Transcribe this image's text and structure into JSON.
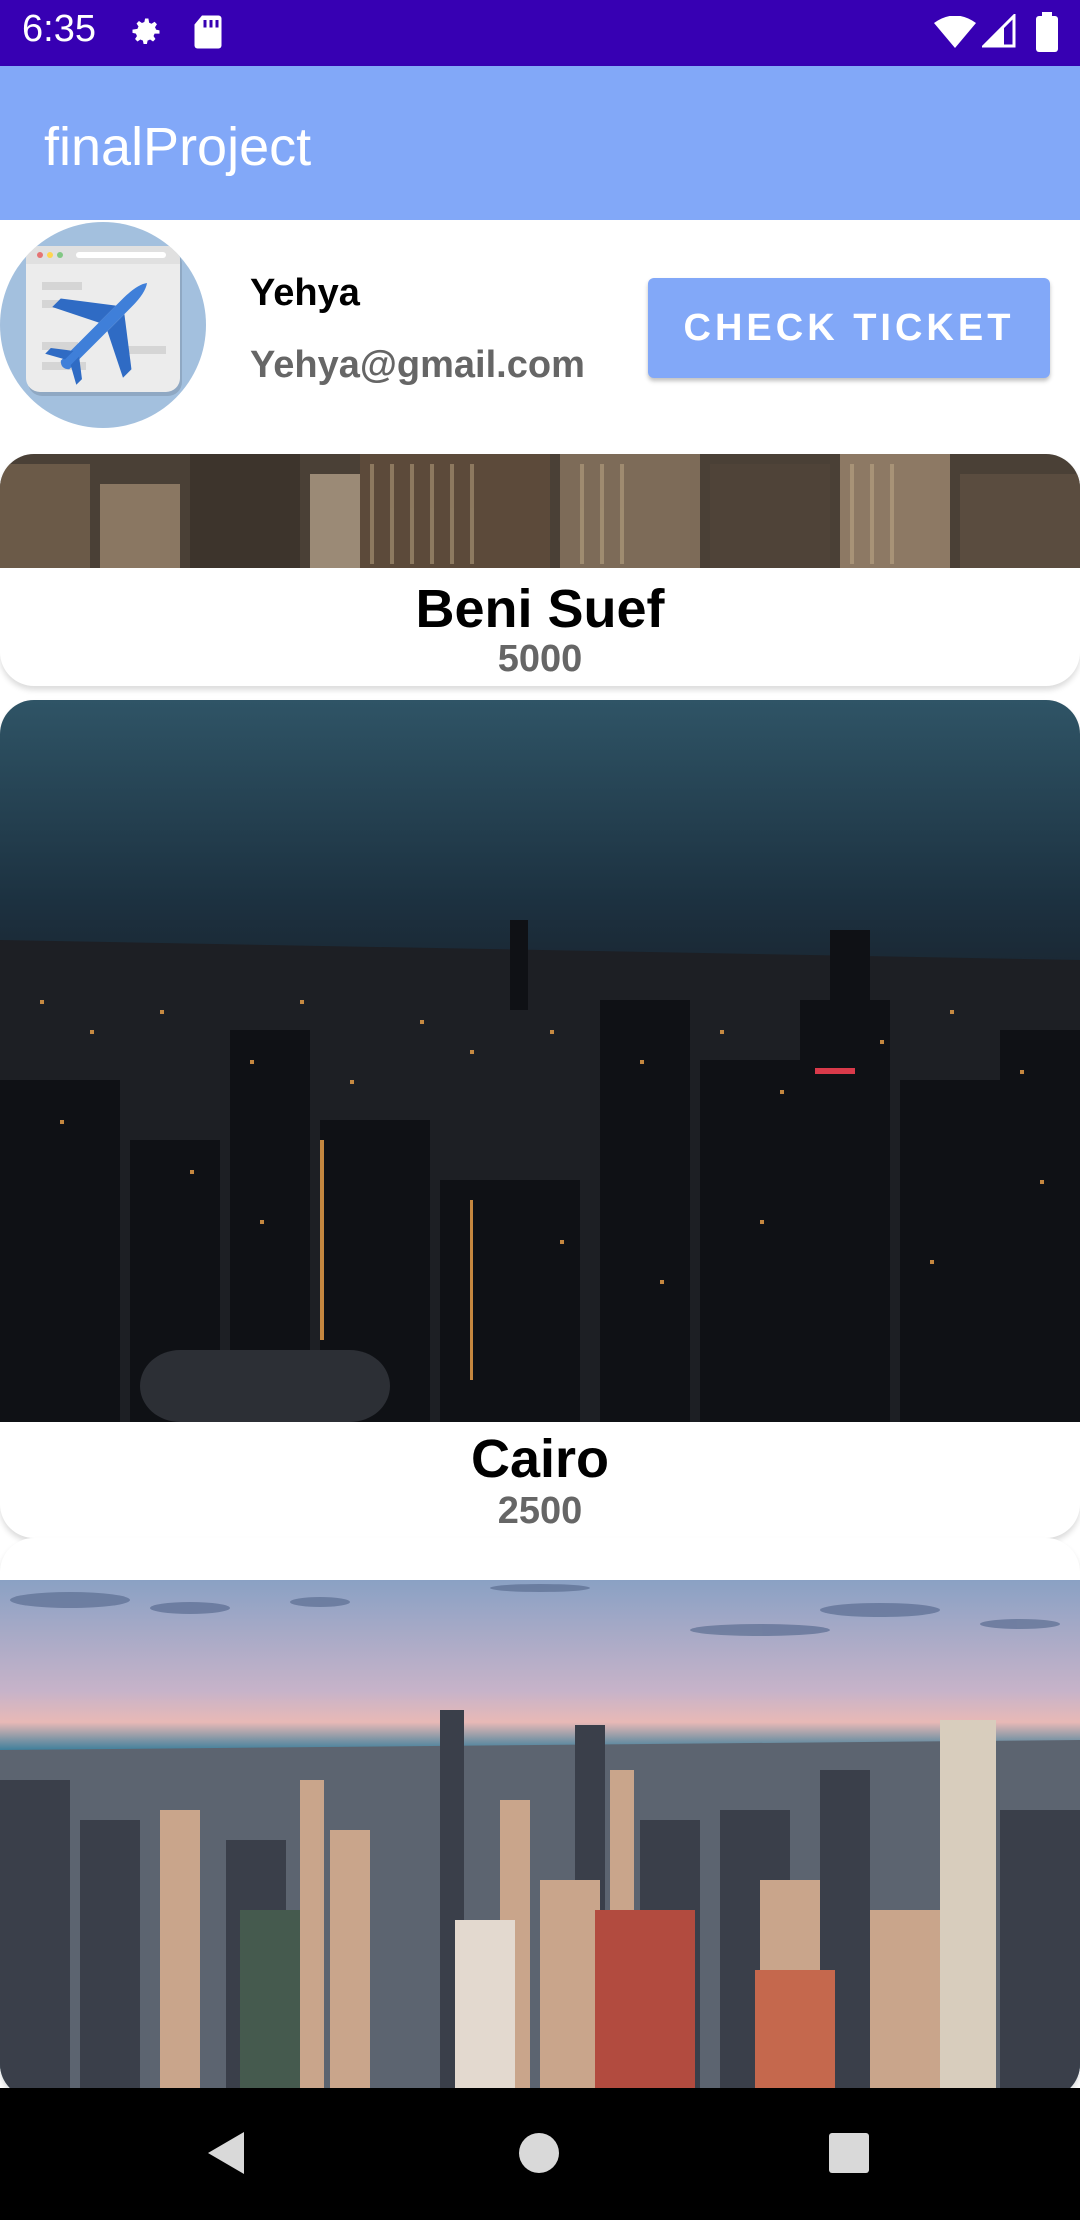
{
  "status_bar": {
    "time": "6:35",
    "icons": [
      "gear-icon",
      "sd-card-icon",
      "wifi-icon",
      "signal-icon",
      "battery-icon"
    ],
    "background": "#3700b3"
  },
  "app_bar": {
    "title": "finalProject",
    "background": "#82a8f8"
  },
  "profile": {
    "avatar_icon": "airplane-browser-icon",
    "name": "Yehya",
    "email": "Yehya@gmail.com",
    "check_ticket_label": "CHECK TICKET"
  },
  "destinations": [
    {
      "city": "Beni Suef",
      "price": "5000",
      "image": "city-skyline-day"
    },
    {
      "city": "Cairo",
      "price": "2500",
      "image": "city-skyline-night"
    },
    {
      "city": "",
      "price": "",
      "image": "city-skyline-sunset"
    }
  ],
  "nav_bar": {
    "icons": [
      "back-icon",
      "home-icon",
      "recents-icon"
    ]
  }
}
